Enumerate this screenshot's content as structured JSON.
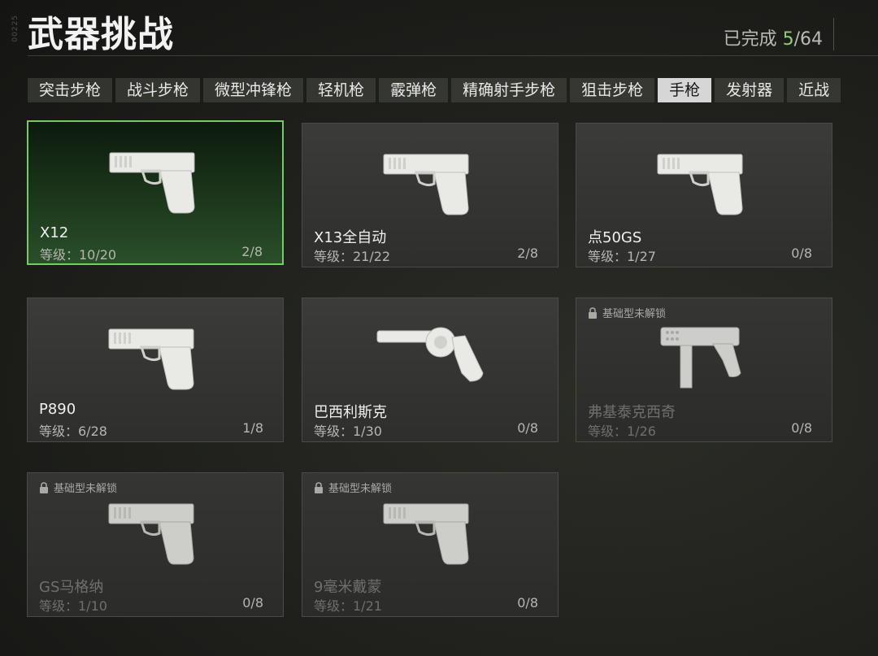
{
  "header": {
    "side_code": "00225",
    "title": "武器挑战",
    "progress_label": "已完成",
    "progress_done": "5",
    "progress_total": "/64"
  },
  "tabs": [
    {
      "label": "突击步枪",
      "active": false
    },
    {
      "label": "战斗步枪",
      "active": false
    },
    {
      "label": "微型冲锋枪",
      "active": false
    },
    {
      "label": "轻机枪",
      "active": false
    },
    {
      "label": "霰弹枪",
      "active": false
    },
    {
      "label": "精确射手步枪",
      "active": false
    },
    {
      "label": "狙击步枪",
      "active": false
    },
    {
      "label": "手枪",
      "active": true
    },
    {
      "label": "发射器",
      "active": false
    },
    {
      "label": "近战",
      "active": false
    }
  ],
  "cards": [
    {
      "name": "X12",
      "level": "等级：10/20",
      "count": "2/8",
      "selected": true,
      "locked": false,
      "lock_label": "",
      "icon": "pistol-icon"
    },
    {
      "name": "X13全自动",
      "level": "等级：21/22",
      "count": "2/8",
      "selected": false,
      "locked": false,
      "lock_label": "",
      "icon": "pistol-icon"
    },
    {
      "name": "点50GS",
      "level": "等级：1/27",
      "count": "0/8",
      "selected": false,
      "locked": false,
      "lock_label": "",
      "icon": "pistol-icon"
    },
    {
      "name": "P890",
      "level": "等级：6/28",
      "count": "1/8",
      "selected": false,
      "locked": false,
      "lock_label": "",
      "icon": "pistol-icon"
    },
    {
      "name": "巴西利斯克",
      "level": "等级：1/30",
      "count": "0/8",
      "selected": false,
      "locked": false,
      "lock_label": "",
      "icon": "revolver-icon"
    },
    {
      "name": "弗基泰克西奇",
      "level": "等级：1/26",
      "count": "0/8",
      "selected": false,
      "locked": true,
      "lock_label": "基础型未解锁",
      "icon": "machine-pistol-icon"
    },
    {
      "name": "GS马格纳",
      "level": "等级：1/10",
      "count": "0/8",
      "selected": false,
      "locked": true,
      "lock_label": "基础型未解锁",
      "icon": "pistol-icon"
    },
    {
      "name": "9毫米戴蒙",
      "level": "等级：1/21",
      "count": "0/8",
      "selected": false,
      "locked": true,
      "lock_label": "基础型未解锁",
      "icon": "pistol-icon"
    }
  ],
  "colors": {
    "accent_green": "#8fd16f",
    "selected_border": "#6fcf5f"
  }
}
